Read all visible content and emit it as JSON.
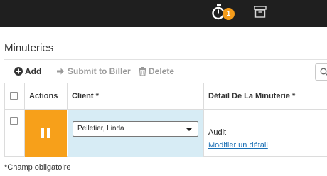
{
  "topbar": {
    "timer_badge_count": "1",
    "icons": [
      "stopwatch-icon",
      "archive-icon"
    ],
    "colors": {
      "background": "#1f1f1f",
      "badge": "#f59c1a"
    }
  },
  "page": {
    "title": "Minuteries"
  },
  "toolbar": {
    "add_label": "Add",
    "submit_label": "Submit to Biller",
    "delete_label": "Delete"
  },
  "table": {
    "columns": {
      "actions": "Actions",
      "client": "Client *",
      "detail": "Détail De La Minuterie *"
    },
    "rows": [
      {
        "client_value": "Pelletier, Linda",
        "detail_text": "Audit",
        "detail_link": "Modifier un détail",
        "action_color": "#f7a01a",
        "client_cell_color": "#d7ecf5"
      }
    ]
  },
  "footer": {
    "required_note": "*Champ obligatoire"
  }
}
